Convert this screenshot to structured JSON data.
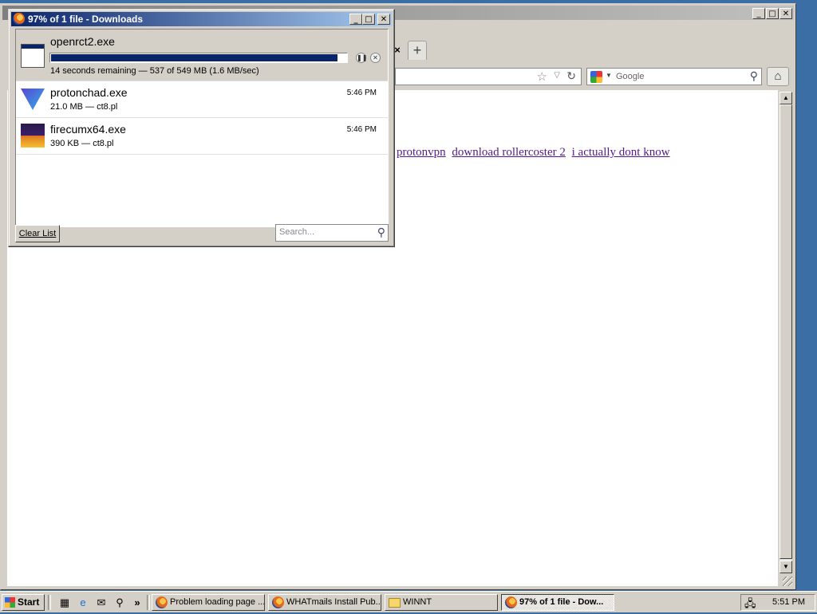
{
  "browser": {
    "search_placeholder": "Google",
    "links": [
      "protonvpn",
      "download rollercoster 2",
      "i actually dont know"
    ],
    "new_tab": "+",
    "tab_close": "×"
  },
  "downloads": {
    "title": "97% of 1 file - Downloads",
    "items": [
      {
        "name": "openrct2.exe",
        "status": "14 seconds remaining — 537 of 549 MB (1.6 MB/sec)",
        "progress": 0.97,
        "icon": "exe-icon"
      },
      {
        "name": "protonchad.exe",
        "status": "21.0 MB — ct8.pl",
        "time": "5:46 PM",
        "icon": "protonvpn-icon"
      },
      {
        "name": "firecumx64.exe",
        "status": "390 KB — ct8.pl",
        "time": "5:46 PM",
        "icon": "firefox-installer-icon"
      }
    ],
    "clear_list": "Clear List",
    "search_placeholder": "Search..."
  },
  "taskbar": {
    "start": "Start",
    "tasks": [
      {
        "label": "Problem loading page ...",
        "icon": "firefox-icon"
      },
      {
        "label": "WHATmails Install Pub...",
        "icon": "firefox-icon"
      },
      {
        "label": "WINNT",
        "icon": "folder-icon"
      },
      {
        "label": "97% of 1 file - Dow...",
        "icon": "firefox-icon",
        "active": true
      }
    ],
    "quicklaunch_more": "»",
    "clock": "5:51 PM"
  },
  "colors": {
    "desktop": "#3a6ea5",
    "titlebar_active": "#0a246a",
    "titlebar_active_end": "#a6caf0",
    "face": "#d4d0c8",
    "visited_link": "#551a8b"
  }
}
